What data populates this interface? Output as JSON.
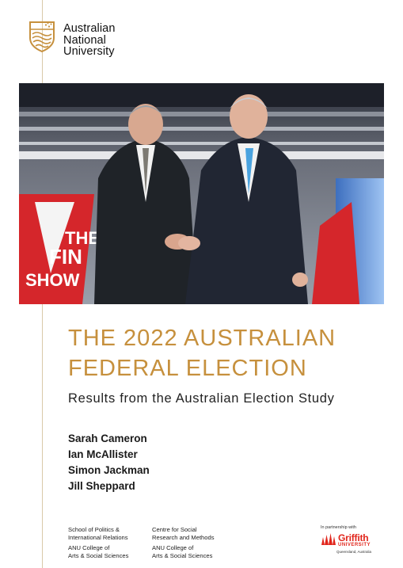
{
  "colors": {
    "accent_gold": "#c6903d",
    "griffith_red": "#e1251b",
    "rule_line": "#d9c9a8"
  },
  "logo": {
    "icon": "anu-crest-icon",
    "lines": [
      "Australian",
      "National",
      "University"
    ]
  },
  "cover_photo": {
    "description_icon": "debate-handshake-photo",
    "backdrop_text": [
      "THE",
      "FIN",
      "SHOW"
    ]
  },
  "title": {
    "line1": "THE 2022 AUSTRALIAN",
    "line2": "FEDERAL ELECTION"
  },
  "subtitle": "Results from the Australian Election Study",
  "authors": [
    "Sarah Cameron",
    "Ian McAllister",
    "Simon Jackman",
    "Jill Sheppard"
  ],
  "affiliations": {
    "left": {
      "school": [
        "School of Politics &",
        "International Relations"
      ],
      "college": [
        "ANU College of",
        "Arts & Social Sciences"
      ]
    },
    "right": {
      "centre": [
        "Centre for Social",
        "Research and Methods"
      ],
      "college": [
        "ANU College of",
        "Arts & Social Sciences"
      ]
    }
  },
  "partner": {
    "label": "In partnership with",
    "name": "Griffith",
    "sub": "UNIVERSITY",
    "location": "Queensland, Australia",
    "icon": "griffith-flame-icon"
  }
}
